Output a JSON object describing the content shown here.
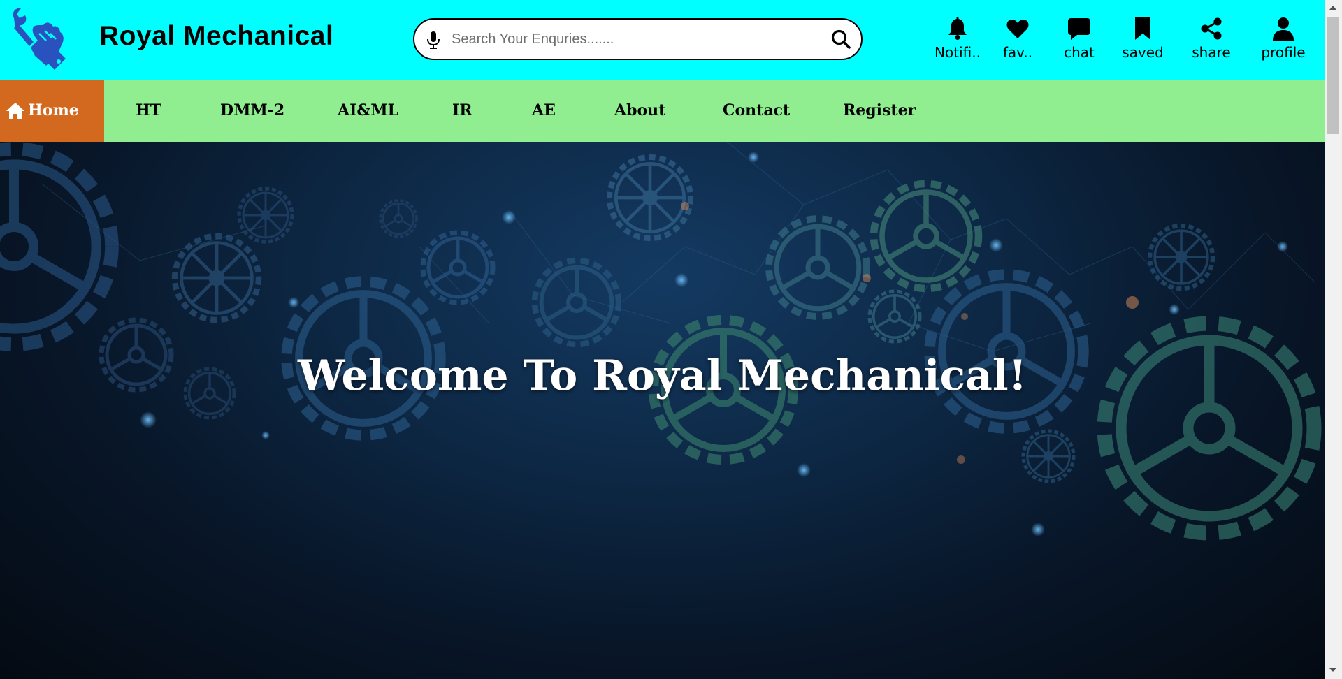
{
  "header": {
    "logo_icon": "wrench-hand-icon",
    "title": "Royal Mechanical",
    "background": "#00ffff"
  },
  "search": {
    "placeholder": "Search Your Enquries.......",
    "value": "",
    "mic_icon": "microphone-icon",
    "search_icon": "magnifier-icon"
  },
  "top_icons": [
    {
      "icon": "bell-icon",
      "label": "Notifi.."
    },
    {
      "icon": "heart-icon",
      "label": "fav.."
    },
    {
      "icon": "chat-icon",
      "label": "chat"
    },
    {
      "icon": "bookmark-icon",
      "label": "saved"
    },
    {
      "icon": "share-icon",
      "label": "share"
    },
    {
      "icon": "user-icon",
      "label": "profile"
    }
  ],
  "menu": {
    "background": "#90ee90",
    "active_background": "#d2691e",
    "home": {
      "icon": "home-icon",
      "label": "Home"
    },
    "items": [
      "HT",
      "DMM-2",
      "AI&ML",
      "IR",
      "AE",
      "About",
      "Contact",
      "Register"
    ]
  },
  "hero": {
    "title": "Welcome To Royal Mechanical!"
  }
}
